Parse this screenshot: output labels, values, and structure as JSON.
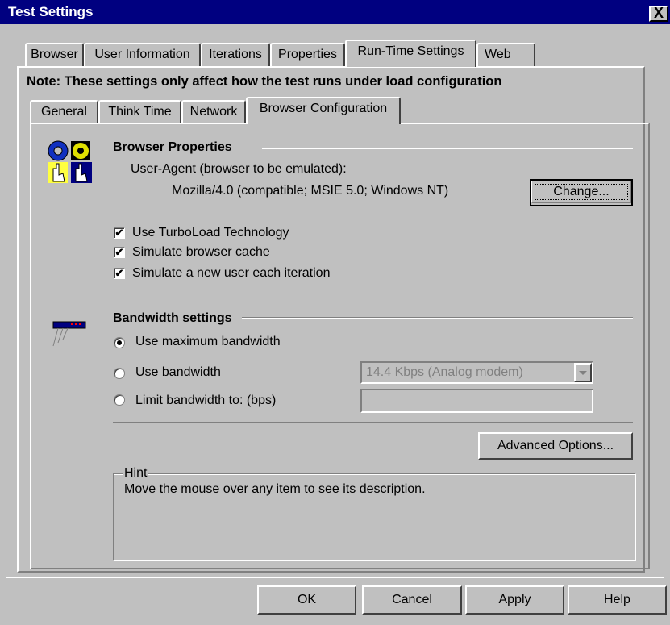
{
  "window": {
    "title": "Test Settings",
    "close_glyph": "X"
  },
  "tabs": [
    {
      "label": "Browser"
    },
    {
      "label": "User Information"
    },
    {
      "label": "Iterations"
    },
    {
      "label": "Properties"
    },
    {
      "label": "Run-Time Settings"
    },
    {
      "label": "Web"
    }
  ],
  "note": "Note: These settings only affect how the test runs under load configuration",
  "subtabs": [
    {
      "label": "General"
    },
    {
      "label": "Think Time"
    },
    {
      "label": "Network"
    },
    {
      "label": "Browser Configuration"
    }
  ],
  "browser_properties": {
    "title": "Browser Properties",
    "user_agent_label": "User-Agent (browser to be emulated):",
    "user_agent_value": "Mozilla/4.0 (compatible; MSIE 5.0; Windows NT)",
    "change_button": "Change...",
    "icon": "browser-properties-icon"
  },
  "options": [
    {
      "label": "Use TurboLoad Technology",
      "checked": true
    },
    {
      "label": "Simulate browser cache",
      "checked": true
    },
    {
      "label": "Simulate a new user each iteration",
      "checked": true
    }
  ],
  "bandwidth": {
    "title": "Bandwidth settings",
    "icon": "modem-icon",
    "radios": [
      {
        "label": "Use maximum bandwidth",
        "selected": true
      },
      {
        "label": "Use bandwidth",
        "selected": false
      },
      {
        "label": "Limit bandwidth to: (bps)",
        "selected": false
      }
    ],
    "select_value": "14.4 Kbps (Analog modem)",
    "limit_value": "",
    "advanced_button": "Advanced Options..."
  },
  "hint": {
    "legend": "Hint",
    "text": "Move the mouse over any item to see its description."
  },
  "footer": {
    "ok": "OK",
    "cancel": "Cancel",
    "apply": "Apply",
    "help": "Help"
  },
  "colors": {
    "titlebar": "#000080",
    "face": "#c0c0c0"
  }
}
